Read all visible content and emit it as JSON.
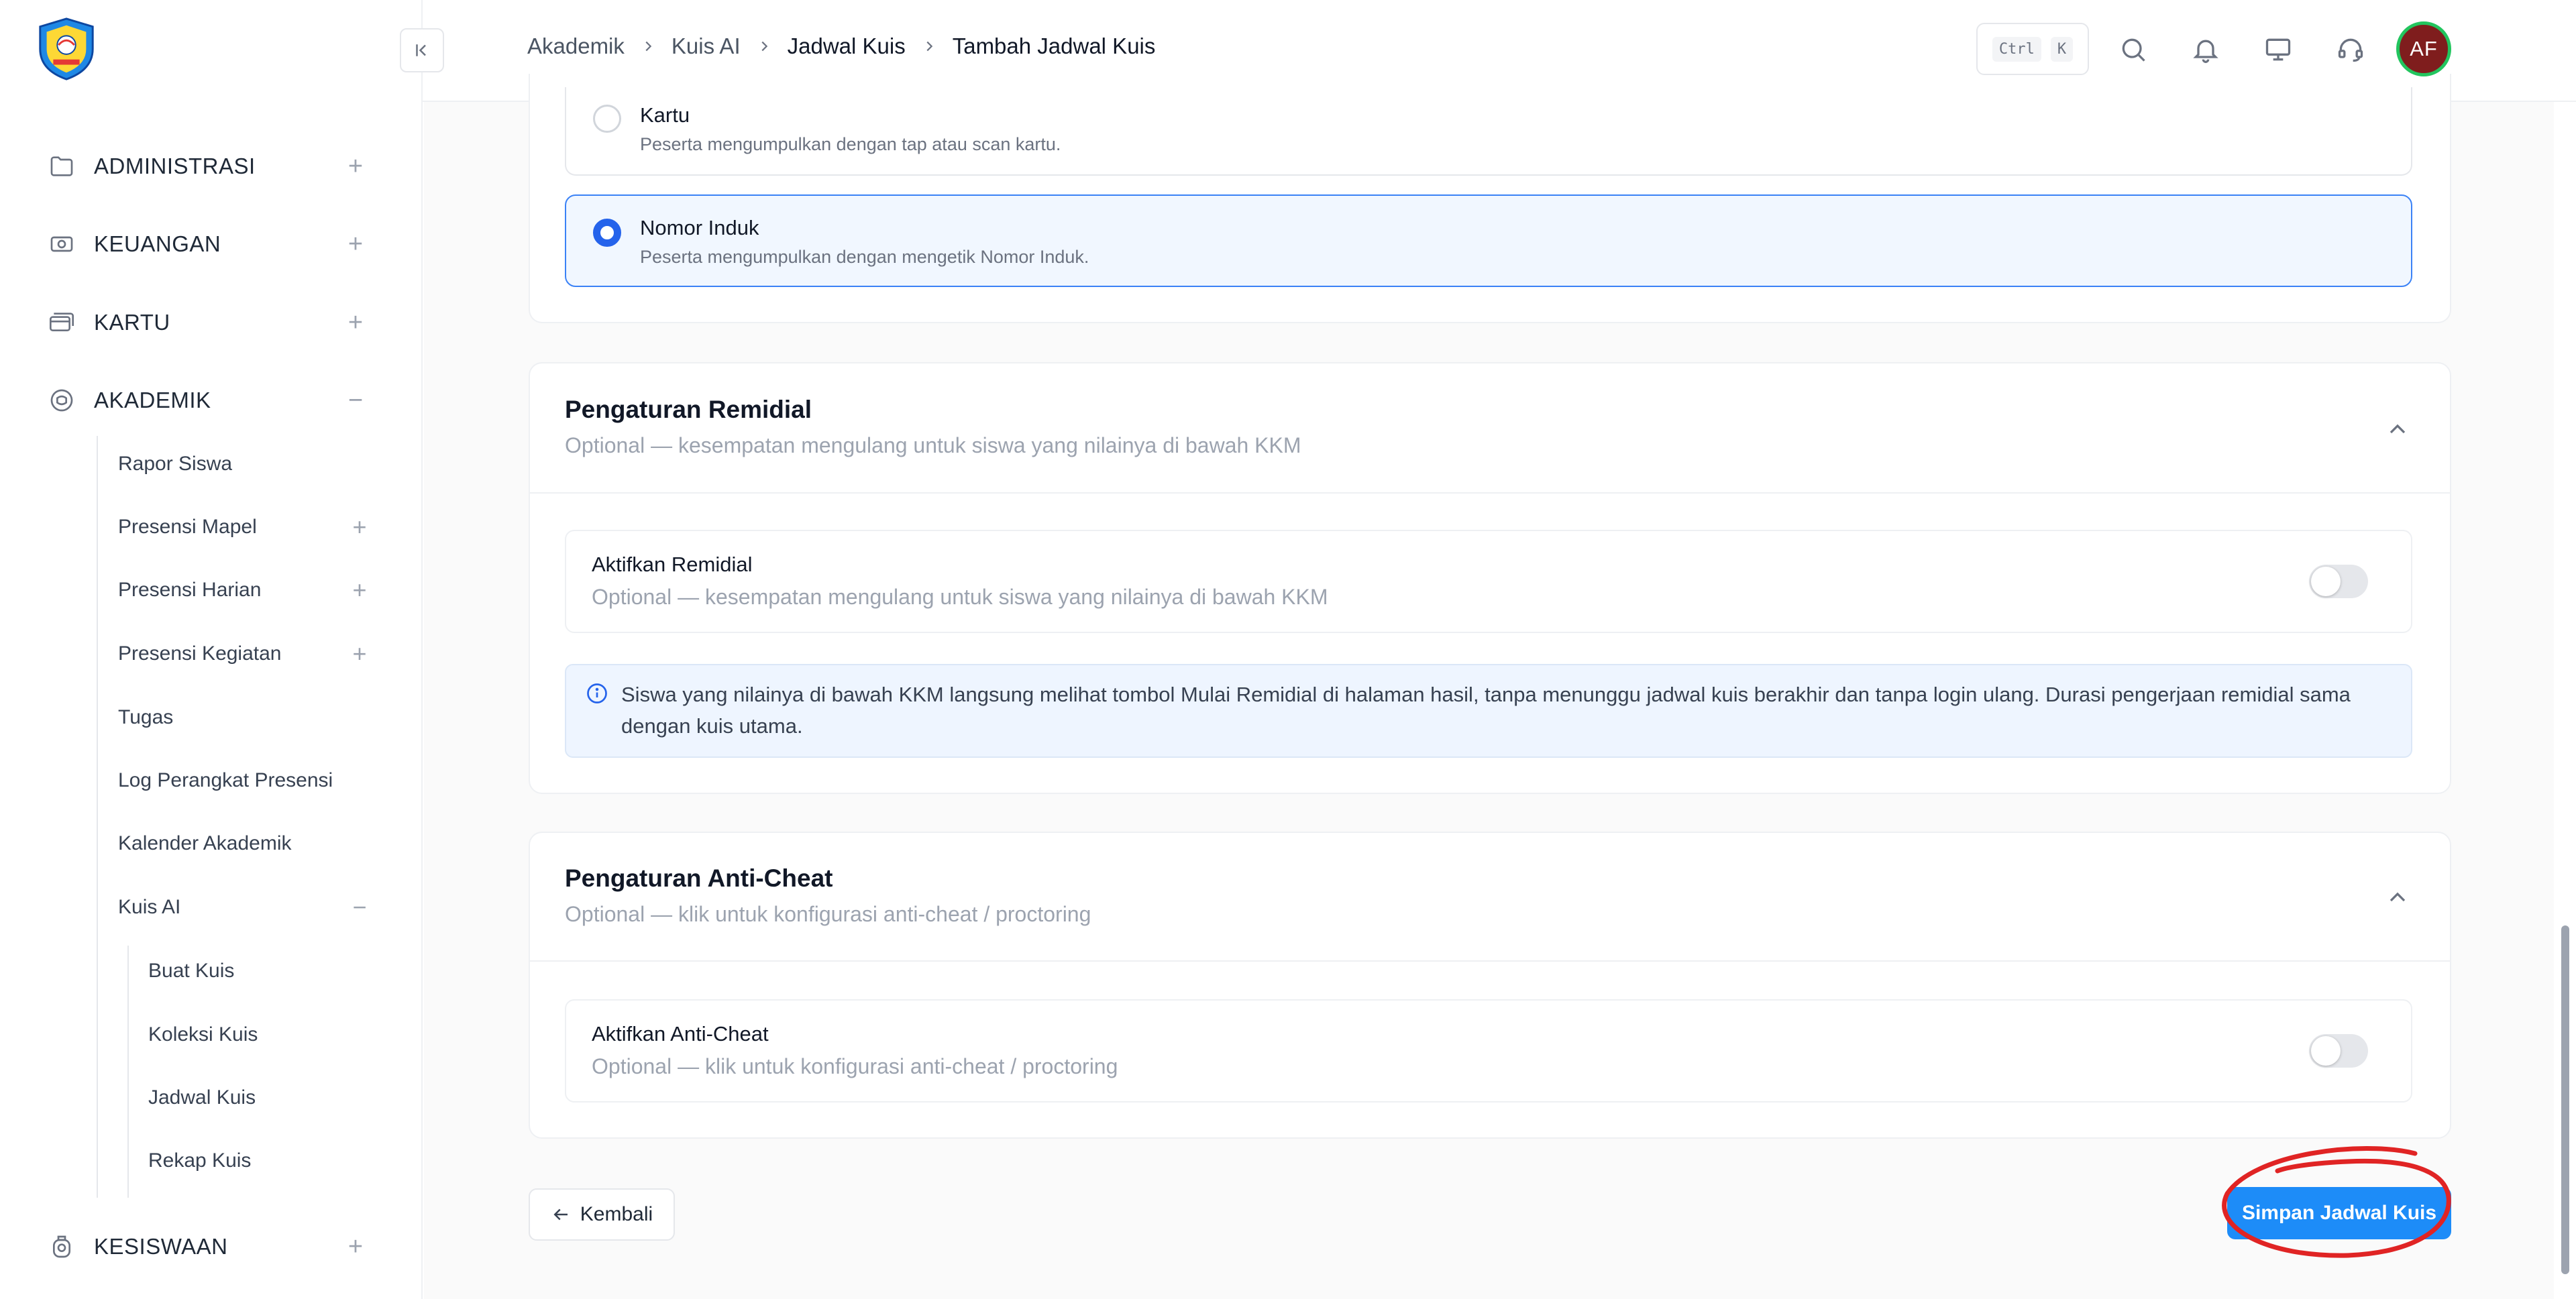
{
  "sidebar": {
    "groups": [
      {
        "label": "ADMINISTRASI",
        "toggle": "+"
      },
      {
        "label": "KEUANGAN",
        "toggle": "+"
      },
      {
        "label": "KARTU",
        "toggle": "+"
      },
      {
        "label": "AKADEMIK",
        "toggle": "−"
      },
      {
        "label": "KESISWAAN",
        "toggle": "+"
      }
    ],
    "akademik_items": [
      {
        "label": "Rapor Siswa",
        "toggle": ""
      },
      {
        "label": "Presensi Mapel",
        "toggle": "+"
      },
      {
        "label": "Presensi Harian",
        "toggle": "+"
      },
      {
        "label": "Presensi Kegiatan",
        "toggle": "+"
      },
      {
        "label": "Tugas",
        "toggle": ""
      },
      {
        "label": "Log Perangkat Presensi",
        "toggle": ""
      },
      {
        "label": "Kalender Akademik",
        "toggle": ""
      },
      {
        "label": "Kuis AI",
        "toggle": "−"
      }
    ],
    "kuis_items": [
      "Buat Kuis",
      "Koleksi Kuis",
      "Jadwal Kuis",
      "Rekap Kuis"
    ]
  },
  "header": {
    "breadcrumb": [
      "Akademik",
      "Kuis AI",
      "Jadwal Kuis",
      "Tambah Jadwal Kuis"
    ],
    "shortcut": {
      "key1": "Ctrl",
      "key2": "K"
    },
    "avatar_initials": "AF"
  },
  "submission": {
    "options": [
      {
        "title": "Kartu",
        "desc": "Peserta mengumpulkan dengan tap atau scan kartu.",
        "selected": false
      },
      {
        "title": "Nomor Induk",
        "desc": "Peserta mengumpulkan dengan mengetik Nomor Induk.",
        "selected": true
      }
    ]
  },
  "remedial": {
    "title": "Pengaturan Remidial",
    "subtitle": "Optional — kesempatan mengulang untuk siswa yang nilainya di bawah KKM",
    "toggle_title": "Aktifkan Remidial",
    "toggle_subtitle": "Optional — kesempatan mengulang untuk siswa yang nilainya di bawah KKM",
    "enabled": false,
    "info": "Siswa yang nilainya di bawah KKM langsung melihat tombol Mulai Remidial di halaman hasil, tanpa menunggu jadwal kuis berakhir dan tanpa login ulang. Durasi pengerjaan remidial sama dengan kuis utama."
  },
  "anticheat": {
    "title": "Pengaturan Anti-Cheat",
    "subtitle": "Optional — klik untuk konfigurasi anti-cheat / proctoring",
    "toggle_title": "Aktifkan Anti-Cheat",
    "toggle_subtitle": "Optional — klik untuk konfigurasi anti-cheat / proctoring",
    "enabled": false
  },
  "actions": {
    "back_label": "Kembali",
    "save_label": "Simpan Jadwal Kuis"
  },
  "colors": {
    "primary": "#1d8cf8",
    "annotation": "#e02424"
  }
}
